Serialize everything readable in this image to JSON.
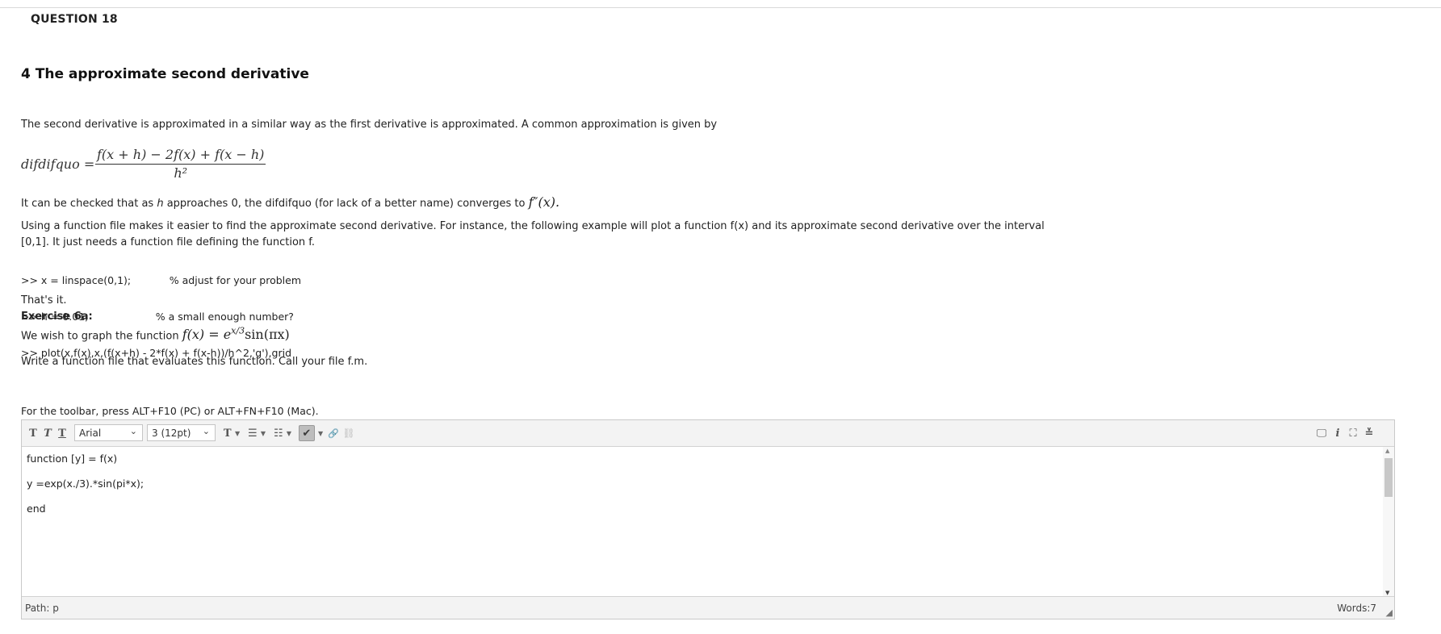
{
  "question": {
    "label": "QUESTION 18"
  },
  "section": {
    "heading": "4  The approximate second derivative",
    "intro": "The second derivative is approximated in a similar way as the first derivative is approximated. A common approximation is given by",
    "formula": {
      "lhs": "difdifquo =",
      "numerator": "f(x + h) − 2f(x) + f(x − h)",
      "denominator": "h²"
    },
    "converge_text_1": "It can be checked that as ",
    "converge_h": "h",
    "converge_text_2": " approaches 0, the difdifquo (for lack of a better name) converges to ",
    "converge_fpp": "f″(x).",
    "using_text": "Using a function file makes it easier to find the approximate second derivative. For instance, the following example will plot a function f(x) and its approximate second derivative over the interval",
    "using_text_2": "[0,1]. It just needs a function file defining the function f.",
    "code_lines": [
      ">> x = linspace(0,1);            % adjust for your problem",
      ">> h = 0.01;                     % a small enough number?",
      ">> plot(x,f(x),x,(f(x+h) - 2*f(x) + f(x-h))/h^2,'g'),grid"
    ],
    "thats_it": "That's it.",
    "exercise_title": "Exercise 6a:",
    "exercise_text": "We wish to graph the function ",
    "exercise_fx": "f(x) = e",
    "exercise_exp": "x/3",
    "exercise_rest": "sin(πx)",
    "write_text": "Write a function file that evaluates this function. Call your file f.m."
  },
  "editor": {
    "toolbar_note": "For the toolbar, press ALT+F10 (PC) or ALT+FN+F10 (Mac).",
    "font_family": "Arial",
    "font_size": "3 (12pt)",
    "lines": [
      "function [y] = f(x)",
      "y =exp(x./3).*sin(pi*x);",
      "end"
    ],
    "path_label": "Path: p",
    "word_count": "Words:7"
  },
  "icons": {
    "bold": "T",
    "italic": "T",
    "underline": "T",
    "text_color": "T",
    "bullet_list": "☰",
    "numbered_list": "☷",
    "spellcheck": "✔",
    "link": "🔗",
    "unlink": "⛓",
    "preview": "🖵",
    "info": "i",
    "fullscreen": "⛶",
    "collapse": "⌄"
  },
  "colors": {
    "toolbar_bg": "#f3f3f3",
    "border": "#c9c9c9",
    "spell_bg": "#bdbdbd"
  }
}
